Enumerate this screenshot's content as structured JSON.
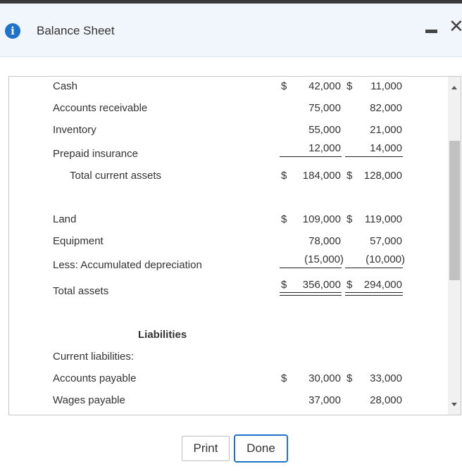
{
  "window": {
    "title": "Balance Sheet",
    "info_icon": "i"
  },
  "rows": [
    {
      "label": "Cash",
      "col1_dollar": "$",
      "col1": "42,000",
      "col2_dollar": "$",
      "col2": "11,000"
    },
    {
      "label": "Accounts receivable",
      "col1": "75,000",
      "col2": "82,000"
    },
    {
      "label": "Inventory",
      "col1": "55,000",
      "col2": "21,000"
    },
    {
      "label": "Prepaid insurance",
      "col1": "12,000",
      "col2": "14,000"
    },
    {
      "label": "Total current assets",
      "col1_dollar": "$",
      "col1": "184,000",
      "col2_dollar": "$",
      "col2": "128,000"
    },
    {
      "label": "Land",
      "col1_dollar": "$",
      "col1": "109,000",
      "col2_dollar": "$",
      "col2": "119,000"
    },
    {
      "label": "Equipment",
      "col1": "78,000",
      "col2": "57,000"
    },
    {
      "label": "Less: Accumulated depreciation",
      "col1": "(15,000)",
      "col2": "(10,000)"
    },
    {
      "label": "Total assets",
      "col1_dollar": "$",
      "col1": "356,000",
      "col2_dollar": "$",
      "col2": "294,000"
    },
    {
      "label": "Current liabilities:"
    },
    {
      "label": "Accounts payable",
      "col1_dollar": "$",
      "col1": "30,000",
      "col2_dollar": "$",
      "col2": "33,000"
    },
    {
      "label": "Wages payable",
      "col1": "37,000",
      "col2": "28,000"
    }
  ],
  "liabilities_heading": "Liabilities",
  "buttons": {
    "print": "Print",
    "done": "Done"
  }
}
